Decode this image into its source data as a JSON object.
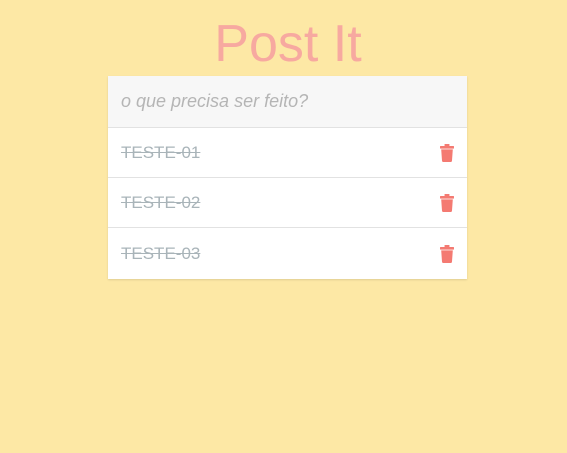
{
  "app": {
    "title": "Post It"
  },
  "new_task": {
    "placeholder": "o que precisa ser feito?",
    "value": ""
  },
  "tasks": [
    {
      "label": "TESTE-01",
      "completed": true
    },
    {
      "label": "TESTE-02",
      "completed": true
    },
    {
      "label": "TESTE-03",
      "completed": true
    }
  ],
  "icons": {
    "delete": "trash-icon"
  },
  "colors": {
    "background": "#fde8a5",
    "title": "#f7a9a0",
    "completed_text": "#a9b4b9",
    "delete_icon": "#f47a72"
  }
}
